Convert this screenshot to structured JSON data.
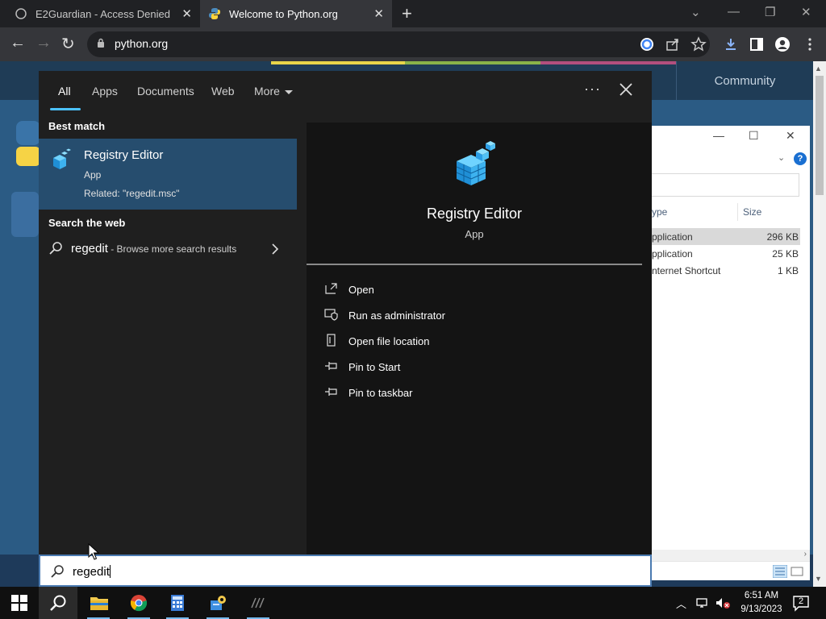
{
  "browser": {
    "tabs": [
      {
        "title": "E2Guardian - Access Denied",
        "active": false
      },
      {
        "title": "Welcome to Python.org",
        "active": true
      }
    ],
    "url": "python.org"
  },
  "python_page": {
    "nav_item": "Community"
  },
  "explorer": {
    "columns": [
      "ype",
      "Size"
    ],
    "rows": [
      {
        "type": "pplication",
        "size": "296 KB",
        "selected": true
      },
      {
        "type": "pplication",
        "size": "25 KB",
        "selected": false
      },
      {
        "type": "nternet Shortcut",
        "size": "1 KB",
        "selected": false
      }
    ]
  },
  "search": {
    "tabs": [
      "All",
      "Apps",
      "Documents",
      "Web",
      "More"
    ],
    "active_tab": "All",
    "best_match_heading": "Best match",
    "best_match": {
      "title": "Registry Editor",
      "subtitle": "App",
      "related": "Related: \"regedit.msc\""
    },
    "web_heading": "Search the web",
    "web_result": {
      "term": "regedit",
      "description": " - Browse more search results"
    },
    "detail": {
      "title": "Registry Editor",
      "type": "App",
      "actions": [
        "Open",
        "Run as administrator",
        "Open file location",
        "Pin to Start",
        "Pin to taskbar"
      ]
    },
    "query": "regedit"
  },
  "taskbar": {
    "time": "6:51 AM",
    "date": "9/13/2023",
    "notifications": "2"
  },
  "colors": {
    "accent": "#4cc2ff",
    "selected_result": "#264d6e",
    "python_blue": "#2b5b84"
  }
}
